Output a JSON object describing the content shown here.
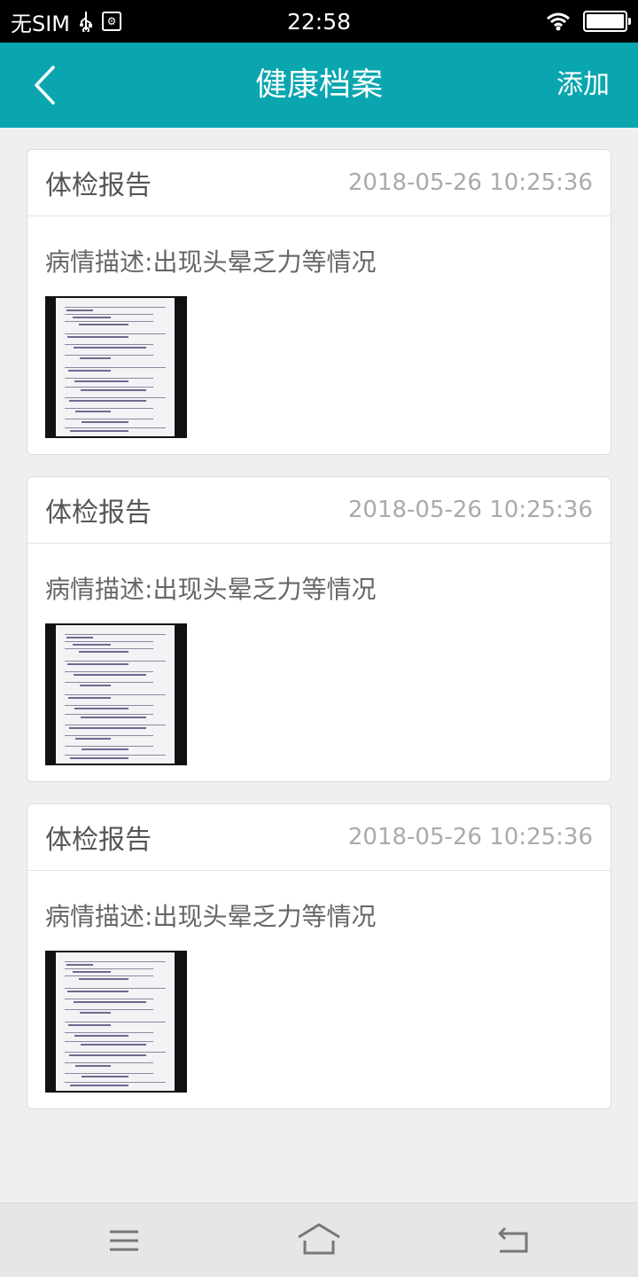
{
  "status_bar": {
    "carrier": "无SIM",
    "time": "22:58",
    "battery_level": 1.0
  },
  "header": {
    "title": "健康档案",
    "add_label": "添加",
    "background_color": "#0aa6b0"
  },
  "records": [
    {
      "type": "体检报告",
      "timestamp": "2018-05-26 10:25:36",
      "description_label": "病情描述:",
      "description": "出现头晕乏力等情况"
    },
    {
      "type": "体检报告",
      "timestamp": "2018-05-26 10:25:36",
      "description_label": "病情描述:",
      "description": "出现头晕乏力等情况"
    },
    {
      "type": "体检报告",
      "timestamp": "2018-05-26 10:25:36",
      "description_label": "病情描述:",
      "description": "出现头晕乏力等情况"
    }
  ],
  "icons": {
    "back": "chevron-left-icon",
    "usb": "usb-icon",
    "debug": "debug-icon",
    "wifi": "wifi-icon",
    "battery": "battery-icon",
    "menu": "menu-icon",
    "home": "home-icon",
    "return": "return-icon"
  }
}
